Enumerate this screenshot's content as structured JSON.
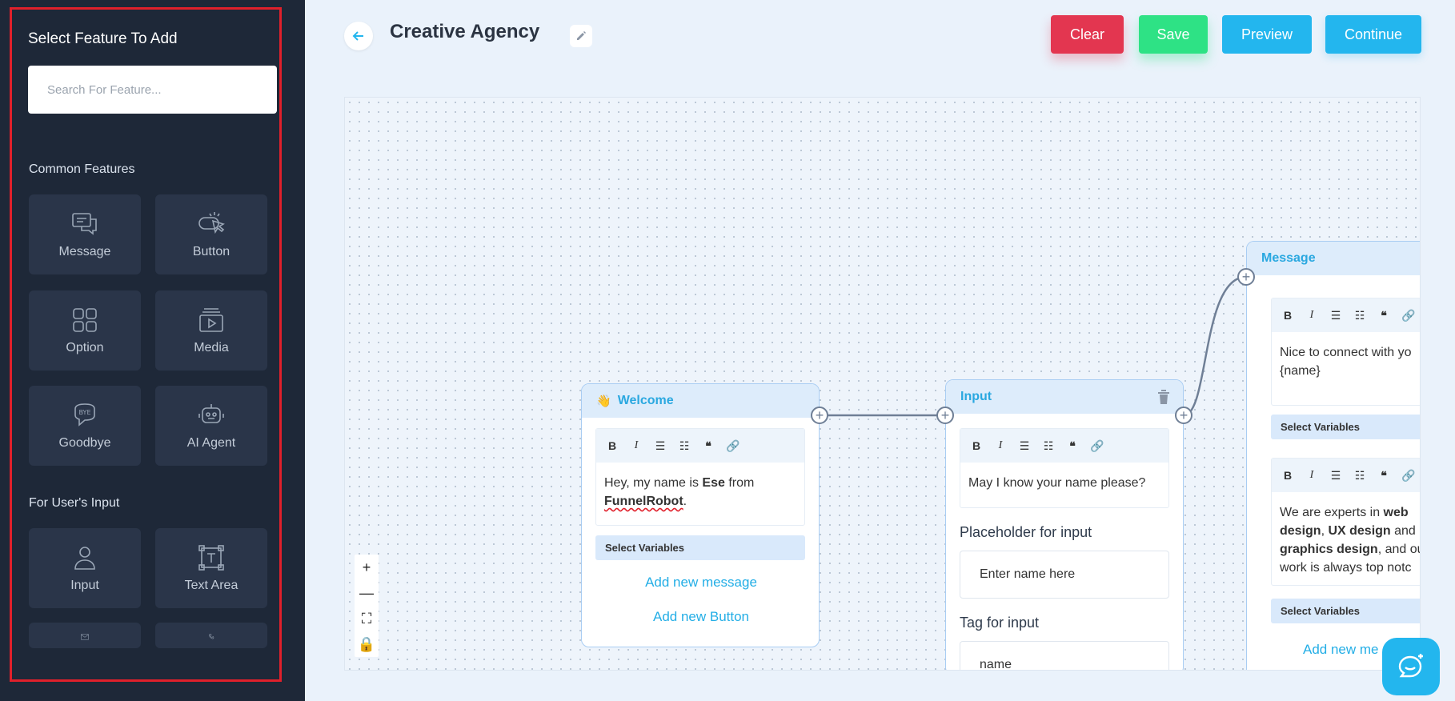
{
  "sidebar": {
    "title": "Select Feature To Add",
    "search_placeholder": "Search For Feature...",
    "common_heading": "Common Features",
    "common": [
      {
        "label": "Message",
        "icon": "message-icon"
      },
      {
        "label": "Button",
        "icon": "button-icon"
      },
      {
        "label": "Option",
        "icon": "option-icon"
      },
      {
        "label": "Media",
        "icon": "media-icon"
      },
      {
        "label": "Goodbye",
        "icon": "goodbye-icon"
      },
      {
        "label": "AI Agent",
        "icon": "ai-agent-icon"
      }
    ],
    "input_heading": "For User's Input",
    "inputs": [
      {
        "label": "Input",
        "icon": "user-icon"
      },
      {
        "label": "Text Area",
        "icon": "text-area-icon"
      }
    ]
  },
  "header": {
    "title": "Creative Agency",
    "buttons": {
      "clear": "Clear",
      "save": "Save",
      "preview": "Preview",
      "continue": "Continue"
    }
  },
  "colors": {
    "clear": "#e33650",
    "save": "#2ee285",
    "primary": "#23b6ee",
    "sidebar": "#1e2838"
  },
  "nodes": {
    "welcome": {
      "emoji": "👋",
      "title": "Welcome",
      "text_pre": "Hey, my name is ",
      "text_name": "Ese",
      "text_mid": " from ",
      "text_brand": "FunnelRobot",
      "text_end": ".",
      "select_variables": "Select Variables",
      "add_message": "Add new message",
      "add_button": "Add new Button"
    },
    "input": {
      "title": "Input",
      "text": "May I know your name please?",
      "placeholder_label": "Placeholder for input",
      "placeholder_value": "Enter name here",
      "tag_label": "Tag for input",
      "tag_value": "name"
    },
    "message": {
      "title": "Message",
      "text1_a": "Nice to connect with yo",
      "text1_b": "{name}",
      "select_variables": "Select Variables",
      "t2_1": "We are experts in ",
      "t2_2": "web",
      "t2_3": "design",
      "t2_4": ", ",
      "t2_5": "UX design",
      "t2_6": " and",
      "t2_7": "graphics design",
      "t2_8": ", and ou",
      "t2_9": "work is always top notc",
      "select_variables2": "Select Variables",
      "add_message": "Add new me"
    }
  }
}
